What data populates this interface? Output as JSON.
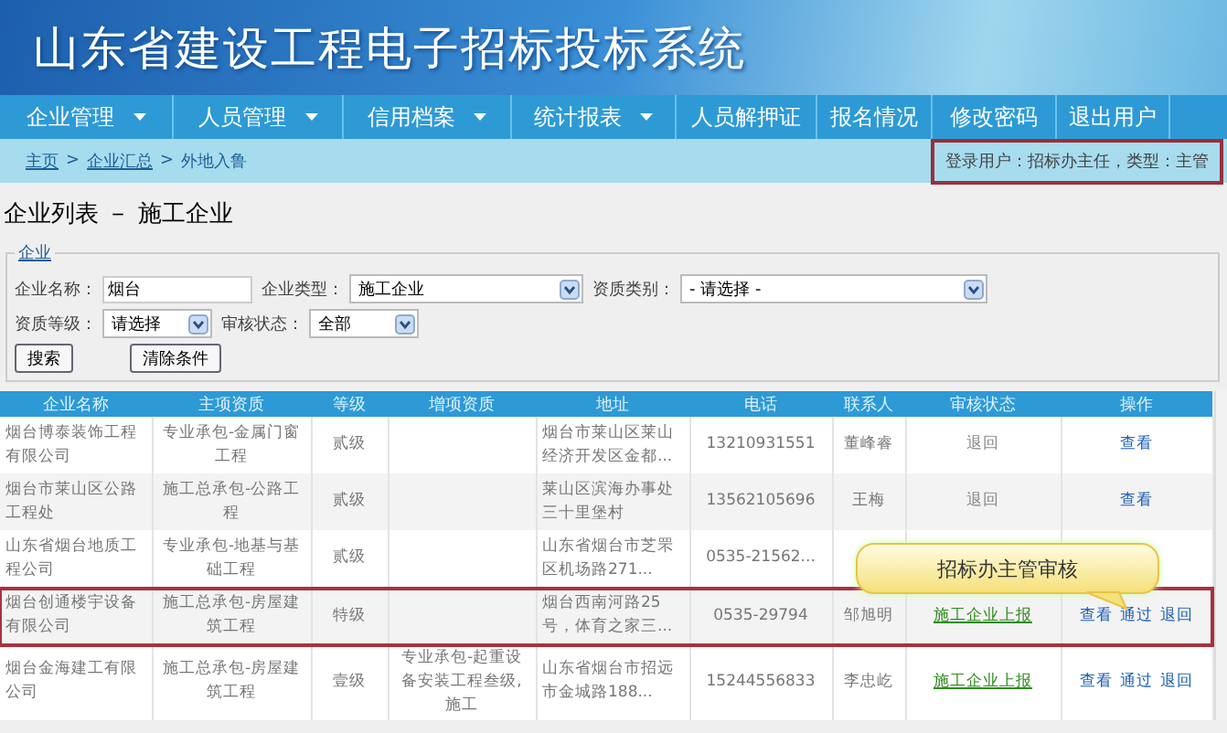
{
  "header": {
    "title": "山东省建设工程电子招标投标系统"
  },
  "nav": [
    {
      "label": "企业管理",
      "has_menu": true
    },
    {
      "label": "人员管理",
      "has_menu": true
    },
    {
      "label": "信用档案",
      "has_menu": true
    },
    {
      "label": "统计报表",
      "has_menu": true
    },
    {
      "label": "人员解押证",
      "has_menu": false
    },
    {
      "label": "报名情况",
      "has_menu": false
    },
    {
      "label": "修改密码",
      "has_menu": false
    },
    {
      "label": "退出用户",
      "has_menu": false
    }
  ],
  "breadcrumb": {
    "items": [
      "主页",
      "企业汇总",
      "外地入鲁"
    ],
    "separator": ">"
  },
  "login_info": {
    "text": "登录用户：招标办主任，类型：主管",
    "highlighted": true
  },
  "page_title": "企业列表 － 施工企业",
  "filter": {
    "legend": "企业",
    "fields": [
      {
        "label": "企业名称：",
        "kind": "text",
        "value": "烟台"
      },
      {
        "label": "企业类型：",
        "kind": "select",
        "value": "施工企业"
      },
      {
        "label": "资质类别：",
        "kind": "select",
        "value": "- 请选择 -"
      },
      {
        "label": "资质等级：",
        "kind": "select",
        "value": "请选择"
      },
      {
        "label": "审核状态：",
        "kind": "select",
        "value": "全部"
      }
    ],
    "buttons": [
      "搜索",
      "清除条件"
    ]
  },
  "table": {
    "columns": [
      "企业名称",
      "主项资质",
      "等级",
      "增项资质",
      "地址",
      "电话",
      "联系人",
      "审核状态",
      "操作"
    ],
    "rows": [
      {
        "name": "烟台博泰装饰工程有限公司",
        "main": "专业承包-金属门窗工程",
        "grade": "贰级",
        "address": "烟台市莱山区莱山经济开发区金都...",
        "phone": "13210931551",
        "contact": "董峰睿",
        "status": {
          "text": "退回",
          "kind": "returned"
        },
        "actions": [
          "查看"
        ],
        "highlighted": false
      },
      {
        "name": "烟台市莱山区公路工程处",
        "main": "施工总承包-公路工程",
        "grade": "贰级",
        "address": "莱山区滨海办事处三十里堡村",
        "phone": "13562105696",
        "contact": "王梅",
        "status": {
          "text": "退回",
          "kind": "returned"
        },
        "actions": [
          "查看"
        ],
        "highlighted": false
      },
      {
        "name": "山东省烟台地质工程公司",
        "main": "专业承包-地基与基础工程",
        "grade": "贰级",
        "address": "山东省烟台市芝罘区机场路271...",
        "phone": "0535-21562...",
        "highlighted": false
      },
      {
        "name": "烟台创通楼宇设备有限公司",
        "main": "施工总承包-房屋建筑工程",
        "grade": "特级",
        "address": "烟台西南河路25号，体育之家三...",
        "phone": "0535-29794",
        "contact": "邹旭明",
        "status": {
          "text": "施工企业上报",
          "kind": "reported"
        },
        "actions": [
          "查看",
          "通过",
          "退回"
        ],
        "highlighted": true
      },
      {
        "name": "烟台金海建工有限公司",
        "main": "施工总承包-房屋建筑工程",
        "grade": "壹级",
        "extra": "专业承包-起重设备安装工程叁级,施工",
        "address": "山东省烟台市招远市金城路188...",
        "phone": "15244556833",
        "contact": "李忠屹",
        "status": {
          "text": "施工企业上报",
          "kind": "reported"
        },
        "actions": [
          "查看",
          "通过",
          "退回"
        ],
        "highlighted": false
      }
    ]
  },
  "callout": {
    "text": "招标办主管审核"
  }
}
